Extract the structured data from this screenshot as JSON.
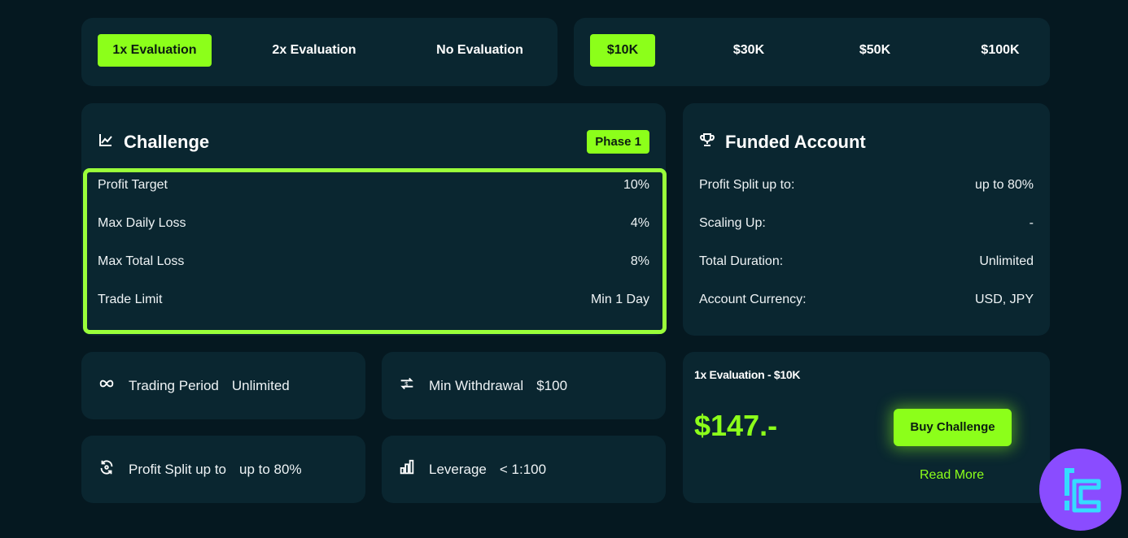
{
  "evaluation_tabs": [
    "1x Evaluation",
    "2x Evaluation",
    "No Evaluation"
  ],
  "size_tabs": [
    "$10K",
    "$30K",
    "$50K",
    "$100K"
  ],
  "challenge": {
    "title": "Challenge",
    "phase": "Phase 1",
    "rows": [
      {
        "label": "Profit Target",
        "value": "10%"
      },
      {
        "label": "Max Daily Loss",
        "value": "4%"
      },
      {
        "label": "Max Total Loss",
        "value": "8%"
      },
      {
        "label": "Trade Limit",
        "value": "Min 1 Day"
      }
    ]
  },
  "funded": {
    "title": "Funded Account",
    "rows": [
      {
        "label": "Profit Split up to:",
        "value": "up to 80%"
      },
      {
        "label": "Scaling Up:",
        "value": "-"
      },
      {
        "label": "Total Duration:",
        "value": "Unlimited"
      },
      {
        "label": "Account Currency:",
        "value": "USD, JPY"
      }
    ]
  },
  "stats": [
    {
      "icon": "infinity-icon",
      "label": "Trading Period",
      "value": "Unlimited"
    },
    {
      "icon": "withdrawal-icon",
      "label": "Min Withdrawal",
      "value": "$100"
    },
    {
      "icon": "split-icon",
      "label": "Profit Split up to",
      "value": "up to 80%"
    },
    {
      "icon": "bar-chart-icon",
      "label": "Leverage",
      "value": "< 1:100"
    }
  ],
  "purchase": {
    "heading": "1x Evaluation - $10K",
    "price": "$147.-",
    "buy_label": "Buy Challenge",
    "read_more": "Read More"
  },
  "colors": {
    "accent": "#8cff1a",
    "background": "#051820",
    "card": "#0a2630",
    "logo": "#8a4cff"
  }
}
